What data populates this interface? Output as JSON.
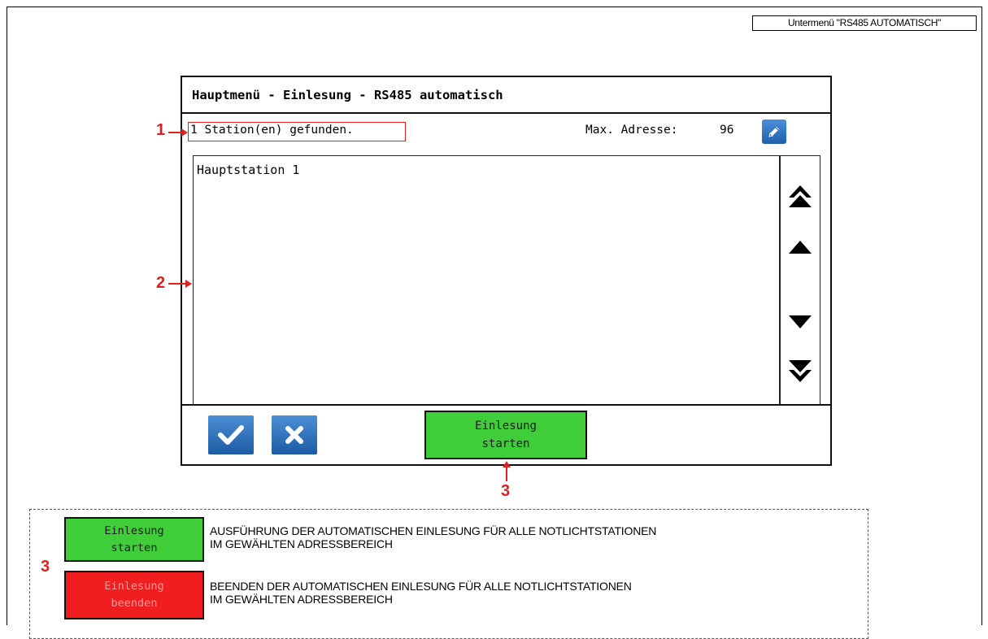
{
  "submenu_label": "Untermenü \"RS485 AUTOMATISCH\"",
  "screen": {
    "title": "Hauptmenü - Einlesung - RS485 automatisch",
    "status_text": "1 Station(en) gefunden.",
    "max_address_label": "Max. Adresse:",
    "max_address_value": "96",
    "list_items": [
      "Hauptstation 1"
    ],
    "start_button_line1": "Einlesung",
    "start_button_line2": "starten"
  },
  "markers": {
    "one": "1",
    "two": "2",
    "three_screen": "3",
    "three_legend": "3"
  },
  "legend": {
    "start_line1": "Einlesung",
    "start_line2": "starten",
    "start_desc_line1": "AUSFÜHRUNG DER AUTOMATISCHEN EINLESUNG FÜR ALLE NOTLICHTSTATIONEN",
    "start_desc_line2": "IM GEWÄHLTEN ADRESSBEREICH",
    "stop_line1": "Einlesung",
    "stop_line2": "beenden",
    "stop_desc_line1": "BEENDEN DER AUTOMATISCHEN EINLESUNG FÜR ALLE NOTLICHTSTATIONEN",
    "stop_desc_line2": "IM GEWÄHLTEN ADRESSBEREICH"
  },
  "colors": {
    "start_green": "#3fce3a",
    "stop_red": "#f01e1e",
    "button_blue": "#2e72bd",
    "annotation_red": "#e02020"
  },
  "icons": {
    "edit": "pencil-icon",
    "scroll_top": "double-chevron-up-icon",
    "scroll_up": "triangle-up-icon",
    "scroll_down": "triangle-down-icon",
    "scroll_bottom": "double-chevron-down-icon",
    "ok": "checkmark-icon",
    "cancel": "close-icon"
  }
}
